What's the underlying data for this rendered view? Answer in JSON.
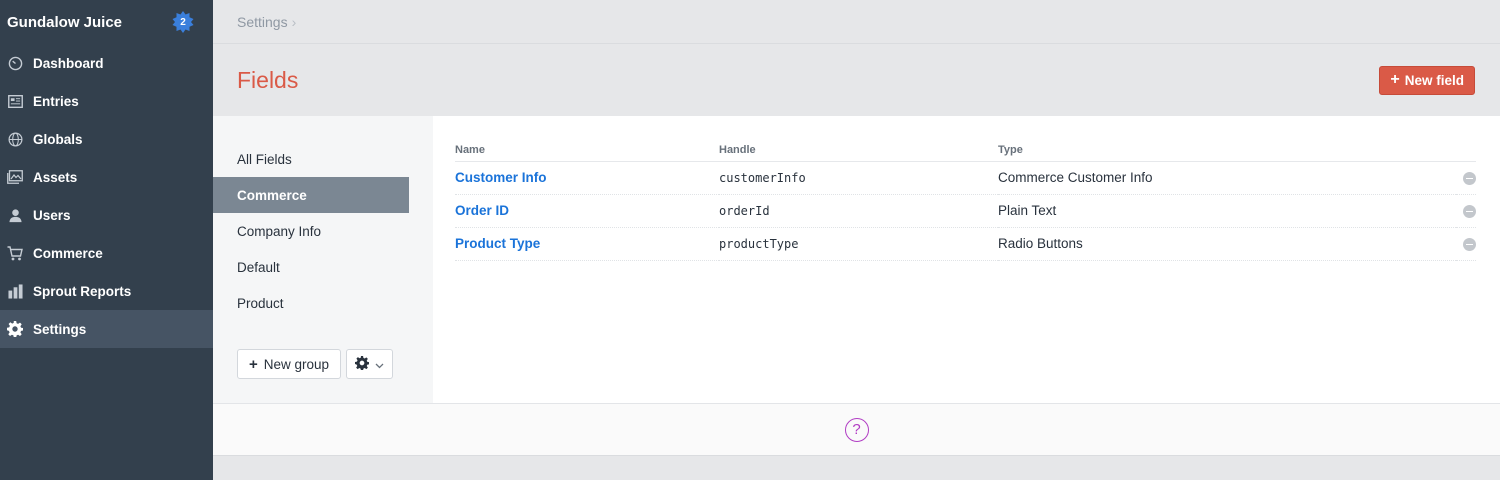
{
  "sidebar": {
    "site_name": "Gundalow Juice",
    "badge_count": "2",
    "items": [
      {
        "label": "Dashboard",
        "icon": "dashboard-icon"
      },
      {
        "label": "Entries",
        "icon": "entries-icon"
      },
      {
        "label": "Globals",
        "icon": "globe-icon"
      },
      {
        "label": "Assets",
        "icon": "assets-icon"
      },
      {
        "label": "Users",
        "icon": "users-icon"
      },
      {
        "label": "Commerce",
        "icon": "cart-icon"
      },
      {
        "label": "Sprout Reports",
        "icon": "bar-chart-icon"
      },
      {
        "label": "Settings",
        "icon": "gear-icon",
        "active": true
      }
    ]
  },
  "breadcrumb": {
    "item": "Settings",
    "separator": "›"
  },
  "header": {
    "title": "Fields",
    "new_field_label": "New field"
  },
  "groups": {
    "items": [
      {
        "label": "All Fields"
      },
      {
        "label": "Commerce",
        "active": true
      },
      {
        "label": "Company Info"
      },
      {
        "label": "Default"
      },
      {
        "label": "Product"
      }
    ],
    "new_group_label": "New group"
  },
  "table": {
    "columns": [
      "Name",
      "Handle",
      "Type"
    ],
    "rows": [
      {
        "name": "Customer Info",
        "handle": "customerInfo",
        "type": "Commerce Customer Info"
      },
      {
        "name": "Order ID",
        "handle": "orderId",
        "type": "Plain Text"
      },
      {
        "name": "Product Type",
        "handle": "productType",
        "type": "Radio Buttons"
      }
    ]
  },
  "colors": {
    "accent": "#da5a47",
    "link": "#1a73d9",
    "sidebar": "#33404d",
    "help": "#b13dc4"
  },
  "footer": {
    "help_icon": "question-icon"
  }
}
